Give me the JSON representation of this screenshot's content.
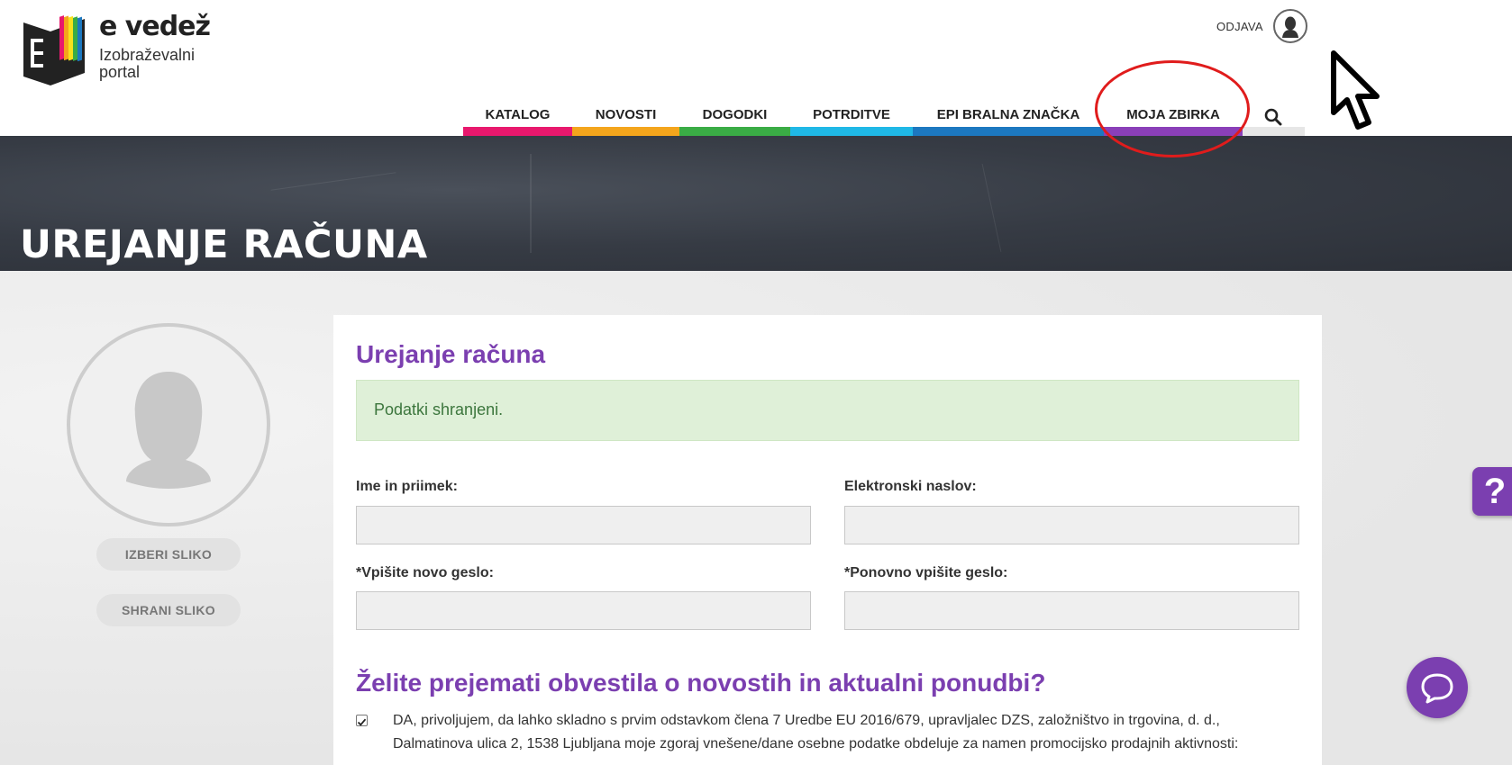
{
  "logo": {
    "title": "e vedež",
    "subtitle_line1": "Izobraževalni",
    "subtitle_line2": "portal"
  },
  "header": {
    "logout_label": "ODJAVA"
  },
  "nav": {
    "items": [
      {
        "label": "KATALOG",
        "color": "#e8186d"
      },
      {
        "label": "NOVOSTI",
        "color": "#f4a51c"
      },
      {
        "label": "DOGODKI",
        "color": "#3aac45"
      },
      {
        "label": "POTRDITVE",
        "color": "#1fb8e6"
      },
      {
        "label": "EPI BRALNA ZNAČKA",
        "color": "#1c78c0"
      },
      {
        "label": "MOJA ZBIRKA",
        "color": "#8a3fb8"
      }
    ],
    "search_bar_color": "#e6e6e6"
  },
  "hero": {
    "title": "UREJANJE RAČUNA"
  },
  "profile": {
    "choose_image_label": "IZBERI SLIKO",
    "save_image_label": "SHRANI SLIKO"
  },
  "form": {
    "title": "Urejanje računa",
    "alert": "Podatki shranjeni.",
    "name_label": "Ime in priimek:",
    "name_value": "",
    "email_label": "Elektronski naslov:",
    "email_value": "",
    "new_password_label": "*Vpišite novo geslo:",
    "repeat_password_label": "*Ponovno vpišite geslo:",
    "newsletter_title": "Želite prejemati obvestila o novostih in aktualni ponudbi?",
    "consent_checked": true,
    "consent_text": "DA, privoljujem, da lahko skladno s prvim odstavkom člena 7 Uredbe EU 2016/679, upravljalec DZS, založništvo in trgovina, d. d., Dalmatinova ulica 2, 1538 Ljubljana moje zgoraj vnešene/dane osebne podatke obdeluje za namen promocijsko prodajnih aktivnosti:"
  },
  "floating": {
    "help_label": "?"
  },
  "colors": {
    "accent": "#7b3fb0",
    "annotation": "#e01c1c"
  }
}
